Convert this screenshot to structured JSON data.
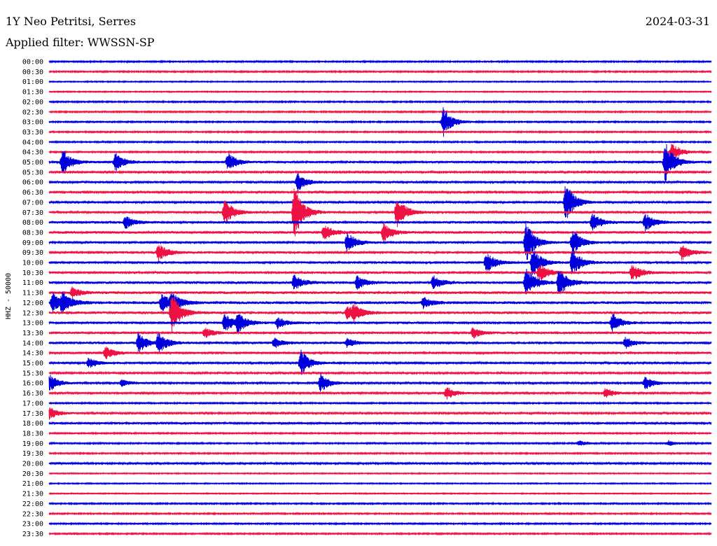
{
  "header": {
    "title": "1Y Neo Petritsi, Serres",
    "date": "2024-03-31",
    "filter": "Applied filter: WWSSN-SP"
  },
  "chart_data": {
    "type": "line",
    "title": "1Y Neo Petritsi, Serres",
    "ylabel": "HHZ - 50000",
    "row_labels": [
      "00:00",
      "00:30",
      "01:00",
      "01:30",
      "02:00",
      "02:30",
      "03:00",
      "03:30",
      "04:00",
      "04:30",
      "05:00",
      "05:30",
      "06:00",
      "06:30",
      "07:00",
      "07:30",
      "08:00",
      "08:30",
      "09:00",
      "09:30",
      "10:00",
      "10:30",
      "11:00",
      "11:30",
      "12:00",
      "12:30",
      "13:00",
      "13:30",
      "14:00",
      "14:30",
      "15:00",
      "15:30",
      "16:00",
      "16:30",
      "17:00",
      "17:30",
      "18:00",
      "18:30",
      "19:00",
      "19:30",
      "20:00",
      "20:30",
      "21:00",
      "21:30",
      "22:00",
      "22:30",
      "23:00",
      "23:30"
    ],
    "series_colors": [
      "#0000dd",
      "#ee1144"
    ],
    "noise_level": [
      1,
      1,
      0.8,
      0.8,
      1,
      1,
      1,
      1,
      1,
      1,
      1.5,
      1.2,
      1.5,
      1.3,
      1.3,
      1.5,
      1.6,
      1.8,
      1.5,
      1.6,
      1.6,
      1.6,
      1.8,
      1.8,
      2,
      1.8,
      1.6,
      1.6,
      1.6,
      1.5,
      1.3,
      1.2,
      1.2,
      1.2,
      1,
      1.2,
      1.5,
      1,
      1,
      1,
      1.2,
      0.8,
      0.8,
      0.8,
      1,
      1,
      1,
      1
    ],
    "events": [
      {
        "row": 6,
        "t": 0.595,
        "amp": 22
      },
      {
        "row": 9,
        "t": 0.94,
        "amp": 15
      },
      {
        "row": 10,
        "t": 0.02,
        "amp": 20
      },
      {
        "row": 10,
        "t": 0.1,
        "amp": 14
      },
      {
        "row": 10,
        "t": 0.27,
        "amp": 14
      },
      {
        "row": 10,
        "t": 0.93,
        "amp": 30
      },
      {
        "row": 12,
        "t": 0.375,
        "amp": 14
      },
      {
        "row": 14,
        "t": 0.78,
        "amp": 30
      },
      {
        "row": 15,
        "t": 0.265,
        "amp": 20
      },
      {
        "row": 15,
        "t": 0.37,
        "amp": 42
      },
      {
        "row": 15,
        "t": 0.525,
        "amp": 25
      },
      {
        "row": 16,
        "t": 0.115,
        "amp": 10
      },
      {
        "row": 16,
        "t": 0.82,
        "amp": 14
      },
      {
        "row": 16,
        "t": 0.9,
        "amp": 14
      },
      {
        "row": 17,
        "t": 0.415,
        "amp": 12
      },
      {
        "row": 17,
        "t": 0.505,
        "amp": 14
      },
      {
        "row": 18,
        "t": 0.45,
        "amp": 16
      },
      {
        "row": 18,
        "t": 0.72,
        "amp": 30
      },
      {
        "row": 18,
        "t": 0.79,
        "amp": 20
      },
      {
        "row": 19,
        "t": 0.165,
        "amp": 14
      },
      {
        "row": 19,
        "t": 0.955,
        "amp": 12
      },
      {
        "row": 20,
        "t": 0.66,
        "amp": 16
      },
      {
        "row": 20,
        "t": 0.73,
        "amp": 22
      },
      {
        "row": 20,
        "t": 0.79,
        "amp": 20
      },
      {
        "row": 21,
        "t": 0.74,
        "amp": 14
      },
      {
        "row": 21,
        "t": 0.88,
        "amp": 14
      },
      {
        "row": 22,
        "t": 0.37,
        "amp": 12
      },
      {
        "row": 22,
        "t": 0.465,
        "amp": 10
      },
      {
        "row": 22,
        "t": 0.58,
        "amp": 10
      },
      {
        "row": 22,
        "t": 0.72,
        "amp": 24
      },
      {
        "row": 22,
        "t": 0.77,
        "amp": 22
      },
      {
        "row": 23,
        "t": 0.035,
        "amp": 8
      },
      {
        "row": 24,
        "t": 0.005,
        "amp": 14
      },
      {
        "row": 24,
        "t": 0.02,
        "amp": 14
      },
      {
        "row": 24,
        "t": 0.17,
        "amp": 14
      },
      {
        "row": 24,
        "t": 0.185,
        "amp": 14
      },
      {
        "row": 24,
        "t": 0.565,
        "amp": 8
      },
      {
        "row": 25,
        "t": 0.45,
        "amp": 10
      },
      {
        "row": 25,
        "t": 0.46,
        "amp": 10
      },
      {
        "row": 25,
        "t": 0.185,
        "amp": 30
      },
      {
        "row": 26,
        "t": 0.265,
        "amp": 14
      },
      {
        "row": 26,
        "t": 0.285,
        "amp": 14
      },
      {
        "row": 26,
        "t": 0.345,
        "amp": 8
      },
      {
        "row": 26,
        "t": 0.85,
        "amp": 14
      },
      {
        "row": 27,
        "t": 0.235,
        "amp": 8
      },
      {
        "row": 27,
        "t": 0.64,
        "amp": 8
      },
      {
        "row": 28,
        "t": 0.135,
        "amp": 16
      },
      {
        "row": 28,
        "t": 0.165,
        "amp": 16
      },
      {
        "row": 28,
        "t": 0.34,
        "amp": 8
      },
      {
        "row": 28,
        "t": 0.45,
        "amp": 6
      },
      {
        "row": 28,
        "t": 0.87,
        "amp": 8
      },
      {
        "row": 29,
        "t": 0.085,
        "amp": 10
      },
      {
        "row": 30,
        "t": 0.06,
        "amp": 8
      },
      {
        "row": 30,
        "t": 0.38,
        "amp": 20
      },
      {
        "row": 32,
        "t": 0.0,
        "amp": 14
      },
      {
        "row": 32,
        "t": 0.11,
        "amp": 6
      },
      {
        "row": 32,
        "t": 0.41,
        "amp": 14
      },
      {
        "row": 32,
        "t": 0.9,
        "amp": 10
      },
      {
        "row": 33,
        "t": 0.6,
        "amp": 10
      },
      {
        "row": 33,
        "t": 0.84,
        "amp": 8
      },
      {
        "row": 35,
        "t": 0.0,
        "amp": 10
      },
      {
        "row": 38,
        "t": 0.8,
        "amp": 4
      },
      {
        "row": 38,
        "t": 0.935,
        "amp": 4
      }
    ]
  }
}
